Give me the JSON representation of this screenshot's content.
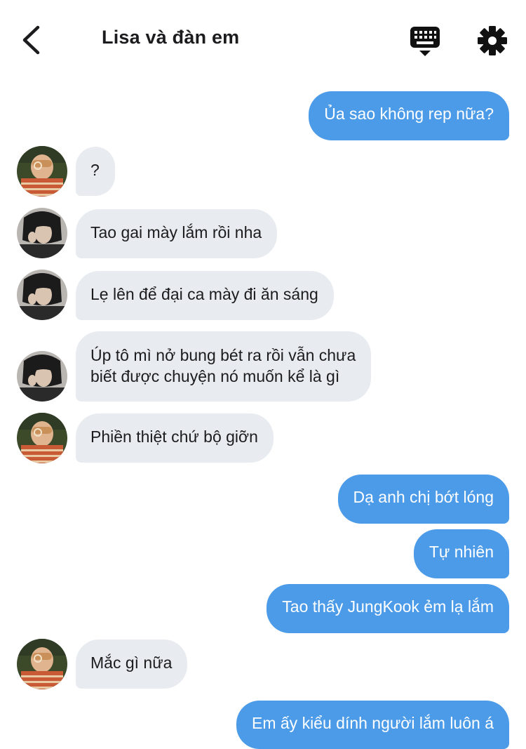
{
  "header": {
    "title": "Lisa và đàn em",
    "back_icon": "chevron-left-icon",
    "keyboard_icon": "keyboard-icon",
    "settings_icon": "gear-icon"
  },
  "colors": {
    "outgoing_bubble": "#4c9be8",
    "incoming_bubble": "#e8ecf0",
    "text_dark": "#1c1c1e"
  },
  "messages": [
    {
      "direction": "outgoing",
      "text": "Ủa sao không rep nữa?"
    },
    {
      "direction": "incoming",
      "sender_avatar": "avatar-2",
      "text": "?"
    },
    {
      "direction": "incoming",
      "sender_avatar": "avatar-1",
      "text": "Tao gai mày lắm rồi nha"
    },
    {
      "direction": "incoming",
      "sender_avatar": "avatar-1",
      "text": "Lẹ lên để đại ca mày đi ăn sáng"
    },
    {
      "direction": "incoming",
      "sender_avatar": "avatar-1",
      "lines": [
        "Úp tô mì nở bung bét ra rồi vẫn chưa",
        "biết được chuyện nó muốn kể là gì"
      ]
    },
    {
      "direction": "incoming",
      "sender_avatar": "avatar-2",
      "text": "Phiền thiệt chứ bộ giỡn"
    },
    {
      "direction": "outgoing",
      "text": "Dạ anh chị bớt lóng"
    },
    {
      "direction": "outgoing",
      "text": "Tự nhiên"
    },
    {
      "direction": "outgoing",
      "text": "Tao thấy JungKook ẻm lạ lắm"
    },
    {
      "direction": "incoming",
      "sender_avatar": "avatar-2",
      "text": "Mắc gì nữa"
    },
    {
      "direction": "outgoing",
      "text": "Em ấy kiểu dính người lắm luôn á"
    }
  ]
}
